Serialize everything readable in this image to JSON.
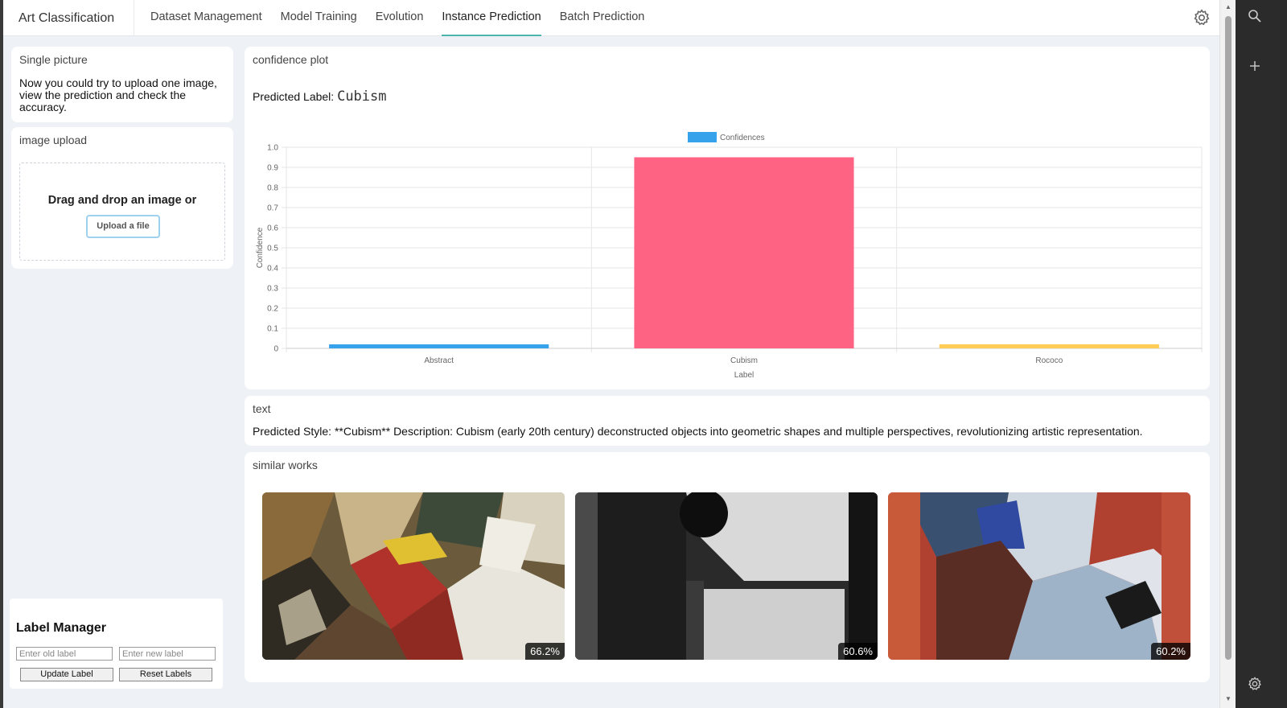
{
  "app": {
    "title": "Art Classification"
  },
  "nav": {
    "tabs": [
      {
        "label": "Dataset Management"
      },
      {
        "label": "Model Training"
      },
      {
        "label": "Evolution"
      },
      {
        "label": "Instance Prediction"
      },
      {
        "label": "Batch Prediction"
      }
    ],
    "active_tab": "Instance Prediction"
  },
  "single": {
    "title": "Single picture",
    "text": "Now you could try to upload one image, view the prediction and check the accuracy."
  },
  "upload": {
    "title": "image upload",
    "drop_text": "Drag and drop an image or",
    "button": "Upload a file"
  },
  "plot": {
    "title": "confidence plot",
    "predicted_prefix": "Predicted Label:",
    "predicted_value": "Cubism"
  },
  "chart_data": {
    "type": "bar",
    "categories": [
      "Abstract",
      "Cubism",
      "Rococo"
    ],
    "series": [
      {
        "name": "Confidences",
        "values": [
          0.02,
          0.95,
          0.02
        ]
      }
    ],
    "bar_colors": [
      "#36a2eb",
      "#ff6384",
      "#ffcd56"
    ],
    "xlabel": "Label",
    "ylabel": "Confidence",
    "ylim": [
      0,
      1.0
    ],
    "yticks": [
      "0",
      "0.1",
      "0.2",
      "0.3",
      "0.4",
      "0.5",
      "0.6",
      "0.7",
      "0.8",
      "0.9",
      "1.0"
    ],
    "legend_position": "top-center",
    "grid": true
  },
  "text_card": {
    "title": "text",
    "body": "Predicted Style: **Cubism** Description: Cubism (early 20th century) deconstructed objects into geometric shapes and multiple perspectives, revolutionizing artistic representation."
  },
  "similar": {
    "title": "similar works",
    "items": [
      {
        "score": "66.2%"
      },
      {
        "score": "60.6%"
      },
      {
        "score": "60.2%"
      }
    ]
  },
  "label_manager": {
    "title": "Label Manager",
    "old_placeholder": "Enter old label",
    "new_placeholder": "Enter new label",
    "update_button": "Update Label",
    "reset_button": "Reset Labels"
  },
  "icons": {
    "settings": "gear-icon",
    "search": "search-icon",
    "add": "plus-icon",
    "side_settings": "gear-icon"
  }
}
